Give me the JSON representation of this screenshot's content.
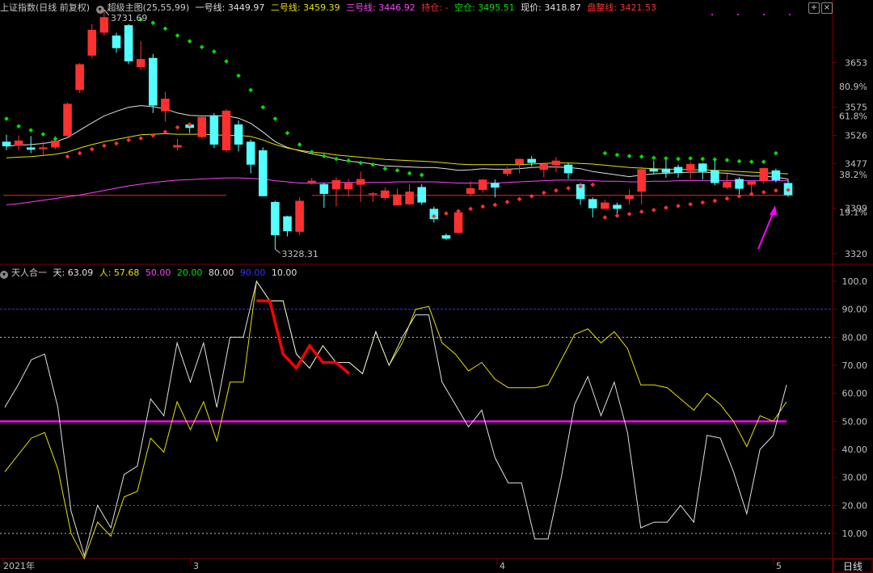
{
  "header_main": {
    "index_name": "上证指数",
    "period_info": "(日线 前复权)",
    "indicator_name": "超级主图(25,55,99)",
    "items": [
      {
        "label": "一号线: 3449.97",
        "color": "#e0e0e0"
      },
      {
        "label": "二号线: 3459.39",
        "color": "#e8e000"
      },
      {
        "label": "三号线: 3446.92",
        "color": "#ff40ff"
      },
      {
        "label": "持仓: -",
        "color": "#ff3030"
      },
      {
        "label": "空仓: 3495.51",
        "color": "#00e000"
      },
      {
        "label": "现价: 3418.87",
        "color": "#e0e0e0"
      },
      {
        "label": "盘整线: 3421.53",
        "color": "#ff3030"
      }
    ]
  },
  "header_sub": {
    "indicator_name": "天人合一",
    "items": [
      {
        "label": "天: 63.09",
        "color": "#e0e0e0"
      },
      {
        "label": "人: 57.68",
        "color": "#e8e000"
      },
      {
        "label": "50.00",
        "color": "#ff40ff"
      },
      {
        "label": "20.00",
        "color": "#00e000"
      },
      {
        "label": "80.00",
        "color": "#e0e0e0"
      },
      {
        "label": "90.00",
        "color": "#3030ff"
      },
      {
        "label": "10.00",
        "color": "#e0e0e0"
      }
    ]
  },
  "axis": {
    "price_ticks": [
      "3653",
      "3575",
      "3526",
      "3477",
      "3399",
      "3320"
    ],
    "percent_ticks": [
      "80.9%",
      "61.8%",
      "38.2%",
      "19.1%"
    ],
    "osc_ticks": [
      "100.0",
      "90.00",
      "80.00",
      "70.00",
      "60.00",
      "50.00",
      "40.00",
      "30.00",
      "20.00",
      "10.00"
    ],
    "dates": [
      "2021年",
      "3",
      "4",
      "5"
    ],
    "period_button": "日线"
  },
  "annotations": {
    "high_label": "3731.69",
    "low_label": "3328.31"
  },
  "colors": {
    "up": "#ff3030",
    "down": "#54ffff",
    "grid": "#7a0000",
    "consolidation": "#ff2020"
  },
  "chart_data": {
    "type": "candlestick",
    "price_range": [
      3300,
      3745
    ],
    "candles": [
      [
        3515,
        3507,
        3527,
        3500
      ],
      [
        3508,
        3517,
        3526,
        3500
      ],
      [
        3505,
        3501,
        3525,
        3495
      ],
      [
        3502,
        3505,
        3515,
        3492
      ],
      [
        3505,
        3517,
        3525,
        3502
      ],
      [
        3525,
        3581,
        3583,
        3522
      ],
      [
        3605,
        3650,
        3652,
        3600
      ],
      [
        3665,
        3710,
        3720,
        3660
      ],
      [
        3705,
        3732,
        3745,
        3700
      ],
      [
        3700,
        3678,
        3705,
        3670
      ],
      [
        3718,
        3655,
        3720,
        3650
      ],
      [
        3645,
        3659,
        3690,
        3640
      ],
      [
        3661,
        3578,
        3668,
        3565
      ],
      [
        3568,
        3590,
        3602,
        3550
      ],
      [
        3505,
        3509,
        3520,
        3500
      ],
      [
        3545,
        3539,
        3548,
        3530
      ],
      [
        3523,
        3558,
        3561,
        3520
      ],
      [
        3561,
        3510,
        3565,
        3504
      ],
      [
        3500,
        3569,
        3572,
        3497
      ],
      [
        3545,
        3510,
        3552,
        3498
      ],
      [
        3515,
        3475,
        3519,
        3460
      ],
      [
        3500,
        3420,
        3505,
        3420
      ],
      [
        3410,
        3352,
        3412,
        3328
      ],
      [
        3385,
        3359,
        3386,
        3350
      ],
      [
        3358,
        3412,
        3418,
        3352
      ],
      [
        3444,
        3447,
        3452,
        3440
      ],
      [
        3441,
        3424,
        3443,
        3400
      ],
      [
        3432,
        3448,
        3453,
        3402
      ],
      [
        3432,
        3443,
        3450,
        3420
      ],
      [
        3440,
        3450,
        3463,
        3410
      ],
      [
        3424,
        3425,
        3427,
        3410
      ],
      [
        3417,
        3430,
        3435,
        3413
      ],
      [
        3404,
        3423,
        3433,
        3404
      ],
      [
        3406,
        3428,
        3441,
        3404
      ],
      [
        3436,
        3409,
        3441,
        3405
      ],
      [
        3398,
        3380,
        3402,
        3374
      ],
      [
        3352,
        3346,
        3355,
        3344
      ],
      [
        3356,
        3392,
        3392,
        3355
      ],
      [
        3424,
        3434,
        3446,
        3420
      ],
      [
        3431,
        3449,
        3450,
        3426
      ],
      [
        3443,
        3435,
        3449,
        3418
      ],
      [
        3459,
        3467,
        3471,
        3455
      ],
      [
        3476,
        3485,
        3484,
        3460
      ],
      [
        3485,
        3478,
        3490,
        3472
      ],
      [
        3466,
        3476,
        3479,
        3453
      ],
      [
        3474,
        3482,
        3488,
        3462
      ],
      [
        3475,
        3460,
        3478,
        3450
      ],
      [
        3441,
        3415,
        3443,
        3405
      ],
      [
        3415,
        3399,
        3418,
        3383
      ],
      [
        3398,
        3409,
        3414,
        3398
      ],
      [
        3405,
        3398,
        3409,
        3383
      ],
      [
        3415,
        3422,
        3432,
        3405
      ],
      [
        3428,
        3467,
        3472,
        3406
      ],
      [
        3468,
        3463,
        3482,
        3458
      ],
      [
        3468,
        3461,
        3485,
        3452
      ],
      [
        3471,
        3461,
        3475,
        3452
      ],
      [
        3464,
        3476,
        3480,
        3450
      ],
      [
        3477,
        3463,
        3478,
        3449
      ],
      [
        3465,
        3443,
        3485,
        3439
      ],
      [
        3435,
        3445,
        3459,
        3432
      ],
      [
        3450,
        3433,
        3453,
        3420
      ],
      [
        3440,
        3446,
        3446,
        3422
      ],
      [
        3447,
        3469,
        3470,
        3442
      ],
      [
        3465,
        3448,
        3468,
        3444
      ],
      [
        3443,
        3422,
        3450,
        3419
      ]
    ],
    "series": [
      {
        "name": "一号线",
        "color": "#e0e0e0",
        "values": [
          3507,
          3509,
          3510,
          3512,
          3515,
          3522,
          3535,
          3548,
          3560,
          3568,
          3575,
          3578,
          3576,
          3572,
          3565,
          3561,
          3560,
          3560,
          3560,
          3556,
          3547,
          3532,
          3515,
          3505,
          3499,
          3494,
          3490,
          3485,
          3481,
          3479,
          3476,
          3473,
          3472,
          3471,
          3470,
          3470,
          3468,
          3465,
          3466,
          3468,
          3467,
          3467,
          3468,
          3470,
          3471,
          3471,
          3470,
          3468,
          3463,
          3460,
          3457,
          3454,
          3457,
          3459,
          3460,
          3461,
          3462,
          3462,
          3461,
          3460,
          3457,
          3455,
          3455,
          3453,
          3450
        ]
      },
      {
        "name": "二号线",
        "color": "#e8e000",
        "values": [
          3487,
          3488,
          3489,
          3491,
          3493,
          3497,
          3504,
          3510,
          3515,
          3519,
          3523,
          3527,
          3528,
          3529,
          3528,
          3528,
          3528,
          3527,
          3526,
          3526,
          3524,
          3518,
          3510,
          3504,
          3500,
          3497,
          3495,
          3492,
          3490,
          3488,
          3486,
          3484,
          3483,
          3482,
          3481,
          3480,
          3478,
          3476,
          3475,
          3475,
          3475,
          3475,
          3475,
          3476,
          3477,
          3478,
          3478,
          3477,
          3476,
          3474,
          3472,
          3470,
          3469,
          3468,
          3467,
          3467,
          3466,
          3466,
          3465,
          3464,
          3463,
          3462,
          3461,
          3460,
          3459
        ]
      },
      {
        "name": "三号线",
        "color": "#ff40ff",
        "values": [
          3405,
          3407,
          3410,
          3413,
          3416,
          3419,
          3422,
          3426,
          3430,
          3434,
          3438,
          3441,
          3444,
          3446,
          3448,
          3449,
          3450,
          3451,
          3452,
          3452,
          3451,
          3450,
          3447,
          3445,
          3443,
          3443,
          3443,
          3444,
          3444,
          3444,
          3444,
          3444,
          3445,
          3445,
          3445,
          3445,
          3444,
          3443,
          3443,
          3443,
          3443,
          3444,
          3445,
          3446,
          3447,
          3448,
          3448,
          3448,
          3447,
          3446,
          3446,
          3445,
          3445,
          3446,
          3446,
          3447,
          3447,
          3447,
          3447,
          3447,
          3447,
          3447,
          3447,
          3447,
          3447
        ]
      },
      {
        "name": "持仓",
        "color": "#ff3030",
        "values": [
          null,
          null,
          null,
          null,
          null,
          3489,
          3495,
          3502,
          3508,
          3512,
          3518,
          3521,
          3526,
          3532,
          3540,
          3545,
          null,
          null,
          null,
          null,
          null,
          null,
          null,
          null,
          null,
          null,
          null,
          null,
          null,
          null,
          null,
          null,
          null,
          null,
          null,
          3385,
          3390,
          3394,
          3398,
          3402,
          3405,
          3410,
          3415,
          3420,
          3426,
          3430,
          3434,
          3437,
          3440,
          3383,
          3386,
          3389,
          3393,
          3396,
          3400,
          3403,
          3406,
          3409,
          3412,
          3416,
          3420,
          3424,
          3427,
          3430,
          3431
        ]
      },
      {
        "name": "空仓",
        "color": "#00e000",
        "values": [
          3555,
          3542,
          3535,
          3528,
          3520,
          null,
          null,
          null,
          null,
          null,
          null,
          3728,
          3722,
          3712,
          3700,
          3690,
          3680,
          3672,
          3655,
          3630,
          3605,
          3575,
          3555,
          3530,
          3510,
          3497,
          3490,
          3485,
          3482,
          3478,
          3475,
          3468,
          3465,
          3460,
          3457,
          null,
          null,
          null,
          null,
          null,
          null,
          null,
          null,
          null,
          null,
          null,
          null,
          null,
          null,
          3495,
          3492,
          3490,
          3489,
          3487,
          3486,
          3485,
          3486,
          3485,
          3484,
          3483,
          3481,
          3480,
          3480,
          3495,
          null
        ]
      },
      {
        "name": "盘整线",
        "color": "#ff2020",
        "values": [
          3421.53
        ]
      },
      {
        "name": "天",
        "color": "#e0e0e0",
        "values": [
          55,
          63,
          72,
          74,
          55,
          18,
          2,
          20,
          12,
          31,
          34,
          58,
          52,
          78,
          64,
          78,
          55,
          80,
          80,
          100,
          93,
          93,
          74,
          69,
          77,
          71,
          71,
          67,
          82,
          70,
          80,
          88,
          88,
          64,
          56,
          48,
          54,
          37,
          28,
          28,
          8,
          8,
          30,
          56,
          66,
          52,
          64,
          46,
          12,
          14,
          14,
          20,
          14,
          45,
          44,
          32,
          17,
          40,
          45,
          63
        ]
      },
      {
        "name": "人",
        "color": "#e8e000",
        "values": [
          32,
          38,
          44,
          46,
          33,
          10,
          1,
          14,
          9,
          23,
          25,
          44,
          39,
          57,
          47,
          57,
          43,
          64,
          64,
          100,
          93,
          93,
          74,
          69,
          77,
          71,
          71,
          67,
          82,
          70,
          78,
          90,
          91,
          78,
          74,
          68,
          71,
          65,
          62,
          62,
          62,
          63,
          72,
          81,
          83,
          78,
          82,
          76,
          63,
          63,
          62,
          58,
          54,
          60,
          56,
          50,
          41,
          52,
          50,
          57
        ]
      },
      {
        "name": "天-强势段",
        "color": "#ff0000",
        "values": [
          93,
          93,
          74,
          69,
          77,
          71,
          71,
          67
        ]
      }
    ]
  }
}
